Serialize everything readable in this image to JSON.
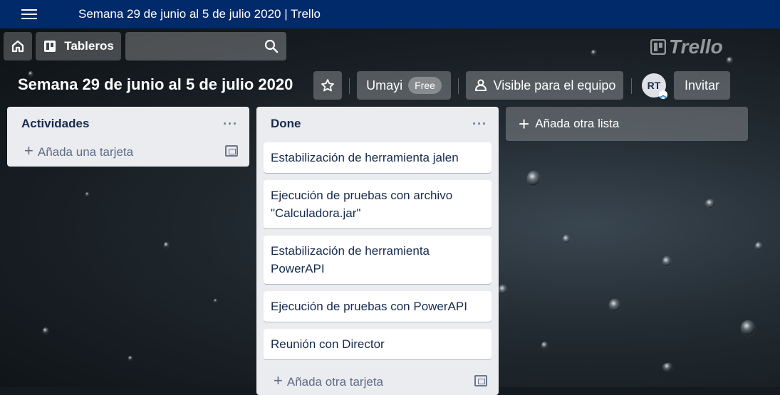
{
  "window": {
    "title": "Semana 29 de junio al 5 de julio 2020 | Trello"
  },
  "nav": {
    "boards_label": "Tableros",
    "logo_text": "Trello"
  },
  "board": {
    "title": "Semana 29 de junio al 5 de julio 2020",
    "team_label": "Umayi",
    "plan_badge": "Free",
    "visibility_label": "Visible para el equipo",
    "member_initials": "RT",
    "invite_label": "Invitar"
  },
  "lists": [
    {
      "title": "Actividades",
      "cards": [],
      "add_card_label": "Añada una tarjeta"
    },
    {
      "title": "Done",
      "cards": [
        "Estabilización de herramienta jalen",
        "Ejecución de pruebas con archivo \"Calculadora.jar\"",
        "Estabilización de herramienta PowerAPI",
        "Ejecución de pruebas con PowerAPI",
        "Reunión con Director"
      ],
      "add_card_label": "Añada otra tarjeta"
    }
  ],
  "add_list_label": "Añada otra lista",
  "menu_glyph": "···",
  "plus_glyph": "+"
}
